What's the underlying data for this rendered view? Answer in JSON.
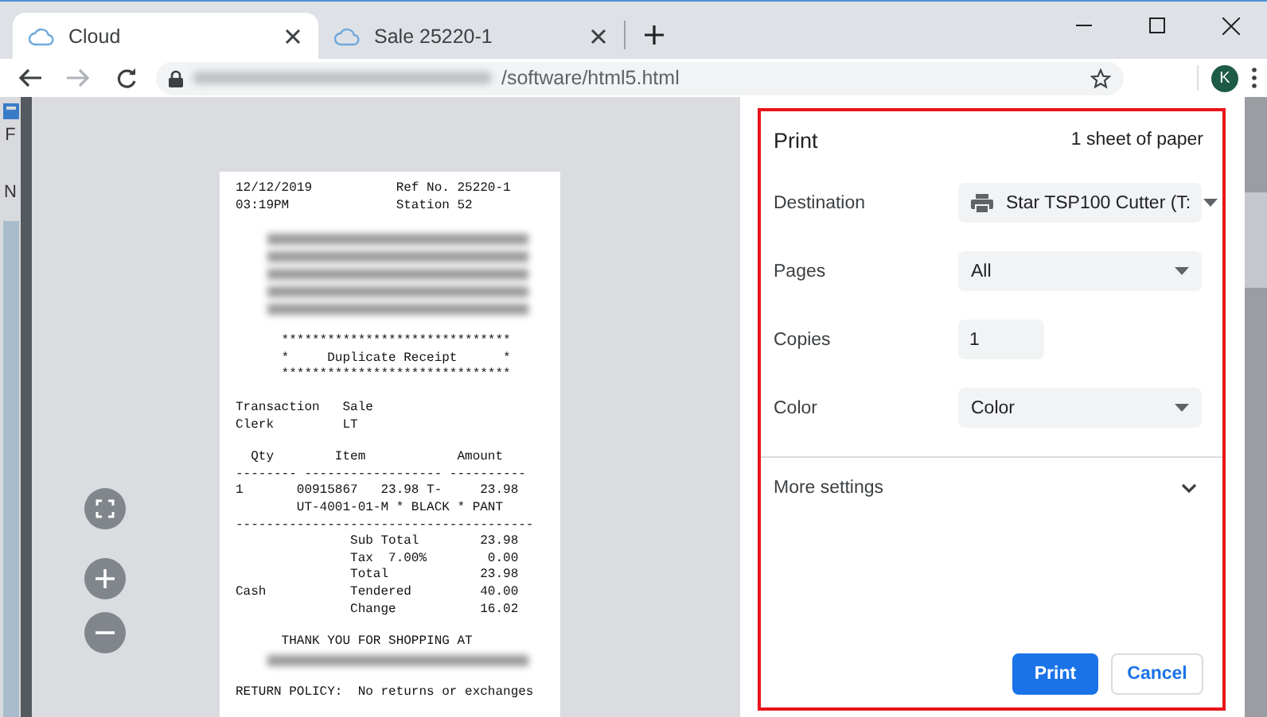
{
  "tabs": [
    {
      "title": "Cloud",
      "selected": true
    },
    {
      "title": "Sale 25220-1",
      "selected": false
    }
  ],
  "address_bar": {
    "path": "/software/html5.html"
  },
  "profile": {
    "initial": "K"
  },
  "background_app": {
    "labels": [
      "F",
      "N"
    ]
  },
  "receipt": {
    "sections": [
      [
        "12/12/2019           Ref No. 25220-1",
        "03:19PM              Station 52"
      ],
      [
        {
          "kind": "redacted"
        },
        {
          "kind": "redacted"
        },
        {
          "kind": "redacted"
        },
        {
          "kind": "redacted"
        },
        {
          "kind": "redacted"
        }
      ],
      [
        "      ******************************",
        "      *     Duplicate Receipt      *",
        "      ******************************"
      ],
      [
        "Transaction   Sale",
        "Clerk         LT"
      ],
      [
        "  Qty        Item            Amount",
        "-------- ------------------ ----------",
        "1       00915867   23.98 T-     23.98",
        "        UT-4001-01-M * BLACK * PANT",
        "---------------------------------------",
        "               Sub Total        23.98",
        "               Tax  7.00%        0.00",
        "               Total            23.98",
        "Cash           Tendered         40.00",
        "               Change           16.02"
      ],
      [
        "      THANK YOU FOR SHOPPING AT",
        {
          "kind": "redacted"
        }
      ],
      [
        "RETURN POLICY:  No returns or exchanges"
      ]
    ]
  },
  "print_panel": {
    "title": "Print",
    "summary": "1 sheet of paper",
    "settings": [
      {
        "label": "Destination",
        "kind": "select",
        "value": "Star TSP100 Cutter (T:"
      },
      {
        "label": "Pages",
        "kind": "select",
        "value": "All"
      },
      {
        "label": "Copies",
        "kind": "input",
        "value": "1"
      },
      {
        "label": "Color",
        "kind": "select",
        "value": "Color"
      }
    ],
    "more_settings": {
      "label": "More settings",
      "expanded": false
    },
    "buttons": [
      {
        "label": "Print",
        "kind": "primary"
      },
      {
        "label": "Cancel",
        "kind": "secondary"
      }
    ]
  }
}
